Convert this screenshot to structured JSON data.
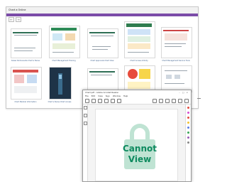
{
  "gallery": {
    "title": "Chart a Online",
    "accent_color": "#7b4ca8",
    "toolbar": [
      "←",
      "→"
    ],
    "captions": [
      "Kaiser Permanente Chart a Nurse",
      "Chart Management Training",
      "Chart Approvals Chart View",
      "Chart Access Activity",
      "Chart Management Service Tools",
      "Chart Medical Information",
      "Chart a Nurse Chart Access",
      "",
      "",
      ""
    ]
  },
  "viewer": {
    "title": "Chart.pdf - Adobe Acrobat Reader",
    "window_controls": "– □ ×",
    "menu": [
      "File",
      "Edit",
      "View",
      "Sign",
      "Window",
      "Help"
    ],
    "lock_color": "#bfe3d3",
    "text_color": "#0e8a5f",
    "message_line1": "Cannot",
    "message_line2": "View"
  }
}
